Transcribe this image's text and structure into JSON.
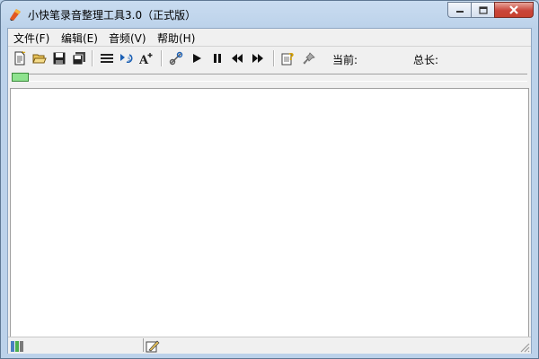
{
  "window": {
    "title": "小快笔录音整理工具3.0（正式版）",
    "icons": {
      "app": "app-logo-icon",
      "minimize": "minimize-icon",
      "maximize": "maximize-icon",
      "close": "close-icon"
    }
  },
  "menu": {
    "items": [
      {
        "label": "文件(F)"
      },
      {
        "label": "编辑(E)"
      },
      {
        "label": "音频(V)"
      },
      {
        "label": "帮助(H)"
      }
    ]
  },
  "toolbar": {
    "buttons": [
      {
        "icon": "new-document-icon"
      },
      {
        "icon": "open-folder-icon"
      },
      {
        "icon": "save-icon"
      },
      {
        "icon": "save-all-icon"
      },
      {
        "icon": "list-icon"
      },
      {
        "icon": "replay-icon"
      },
      {
        "icon": "font-size-icon"
      },
      {
        "icon": "link-icon"
      },
      {
        "icon": "play-icon"
      },
      {
        "icon": "pause-icon"
      },
      {
        "icon": "rewind-icon"
      },
      {
        "icon": "fast-forward-icon"
      },
      {
        "icon": "help-icon"
      },
      {
        "icon": "pin-icon"
      }
    ],
    "current_label": "当前:",
    "total_label": "总长:"
  },
  "progress": {
    "fraction": 0.0
  },
  "statusbar": {
    "icons": [
      "status-columns-icon",
      "status-edit-icon"
    ]
  },
  "colors": {
    "progress_thumb": "#8fe38f",
    "close_button": "#c7412f"
  }
}
